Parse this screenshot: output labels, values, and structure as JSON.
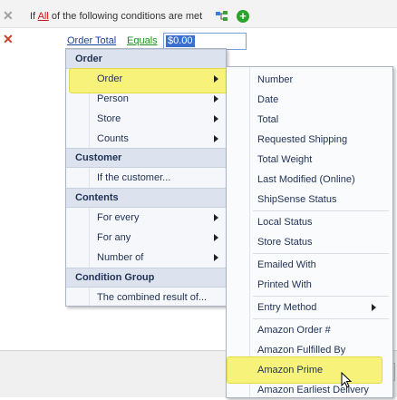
{
  "rule": {
    "if_prefix": "If",
    "if_qualifier": "All",
    "if_suffix": "of the following conditions are met",
    "condition_field": "Order Total",
    "condition_operator": "Equals",
    "condition_value": "$0.00"
  },
  "menu": {
    "groups": [
      {
        "header": "Order",
        "items": [
          "Order",
          "Person",
          "Store",
          "Counts"
        ]
      },
      {
        "header": "Customer",
        "items": [
          "If the customer..."
        ]
      },
      {
        "header": "Contents",
        "items": [
          "For every",
          "For any",
          "Number of"
        ]
      },
      {
        "header": "Condition Group",
        "items": [
          "The combined result of..."
        ]
      }
    ]
  },
  "submenu": {
    "items": [
      "Number",
      "Date",
      "Total",
      "Requested Shipping",
      "Total Weight",
      "Last Modified (Online)",
      "ShipSense Status",
      "Local Status",
      "Store Status",
      "Emailed With",
      "Printed With",
      "Entry Method",
      "Amazon Order #",
      "Amazon Fulfilled By",
      "Amazon Prime",
      "Amazon Earliest Delivery"
    ]
  },
  "colors": {
    "highlight": "#f7f27a",
    "accent": "#2aa32a"
  }
}
